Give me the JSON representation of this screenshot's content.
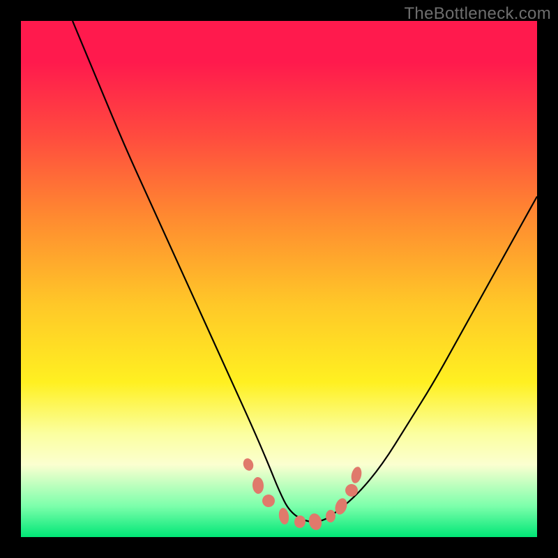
{
  "watermark": "TheBottleneck.com",
  "colors": {
    "frame": "#000000",
    "curve": "#000000",
    "marker_fill": "#e0796b",
    "gradient_stops": [
      "#ff1a4d",
      "#ff4a3f",
      "#ff8a30",
      "#ffc828",
      "#fff021",
      "#fbffa0",
      "#7cffab",
      "#00e676"
    ]
  },
  "chart_data": {
    "type": "line",
    "title": "",
    "xlabel": "",
    "ylabel": "",
    "xlim": [
      0,
      100
    ],
    "ylim": [
      0,
      100
    ],
    "series": [
      {
        "name": "curve",
        "x": [
          10,
          15,
          20,
          25,
          30,
          35,
          40,
          45,
          48,
          50,
          52,
          55,
          58,
          60,
          65,
          70,
          75,
          80,
          85,
          90,
          95,
          100
        ],
        "y": [
          100,
          88,
          76,
          65,
          54,
          43,
          32,
          21,
          14,
          9,
          5,
          3,
          3,
          4,
          8,
          14,
          22,
          30,
          39,
          48,
          57,
          66
        ]
      }
    ],
    "markers": [
      {
        "x": 44,
        "y": 14
      },
      {
        "x": 46,
        "y": 10
      },
      {
        "x": 48,
        "y": 7
      },
      {
        "x": 51,
        "y": 4
      },
      {
        "x": 54,
        "y": 3
      },
      {
        "x": 57,
        "y": 3
      },
      {
        "x": 60,
        "y": 4
      },
      {
        "x": 62,
        "y": 6
      },
      {
        "x": 64,
        "y": 9
      },
      {
        "x": 65,
        "y": 12
      }
    ],
    "note": "x and y are normalized 0-100 relative to the plot area; y=0 is the bottom."
  }
}
